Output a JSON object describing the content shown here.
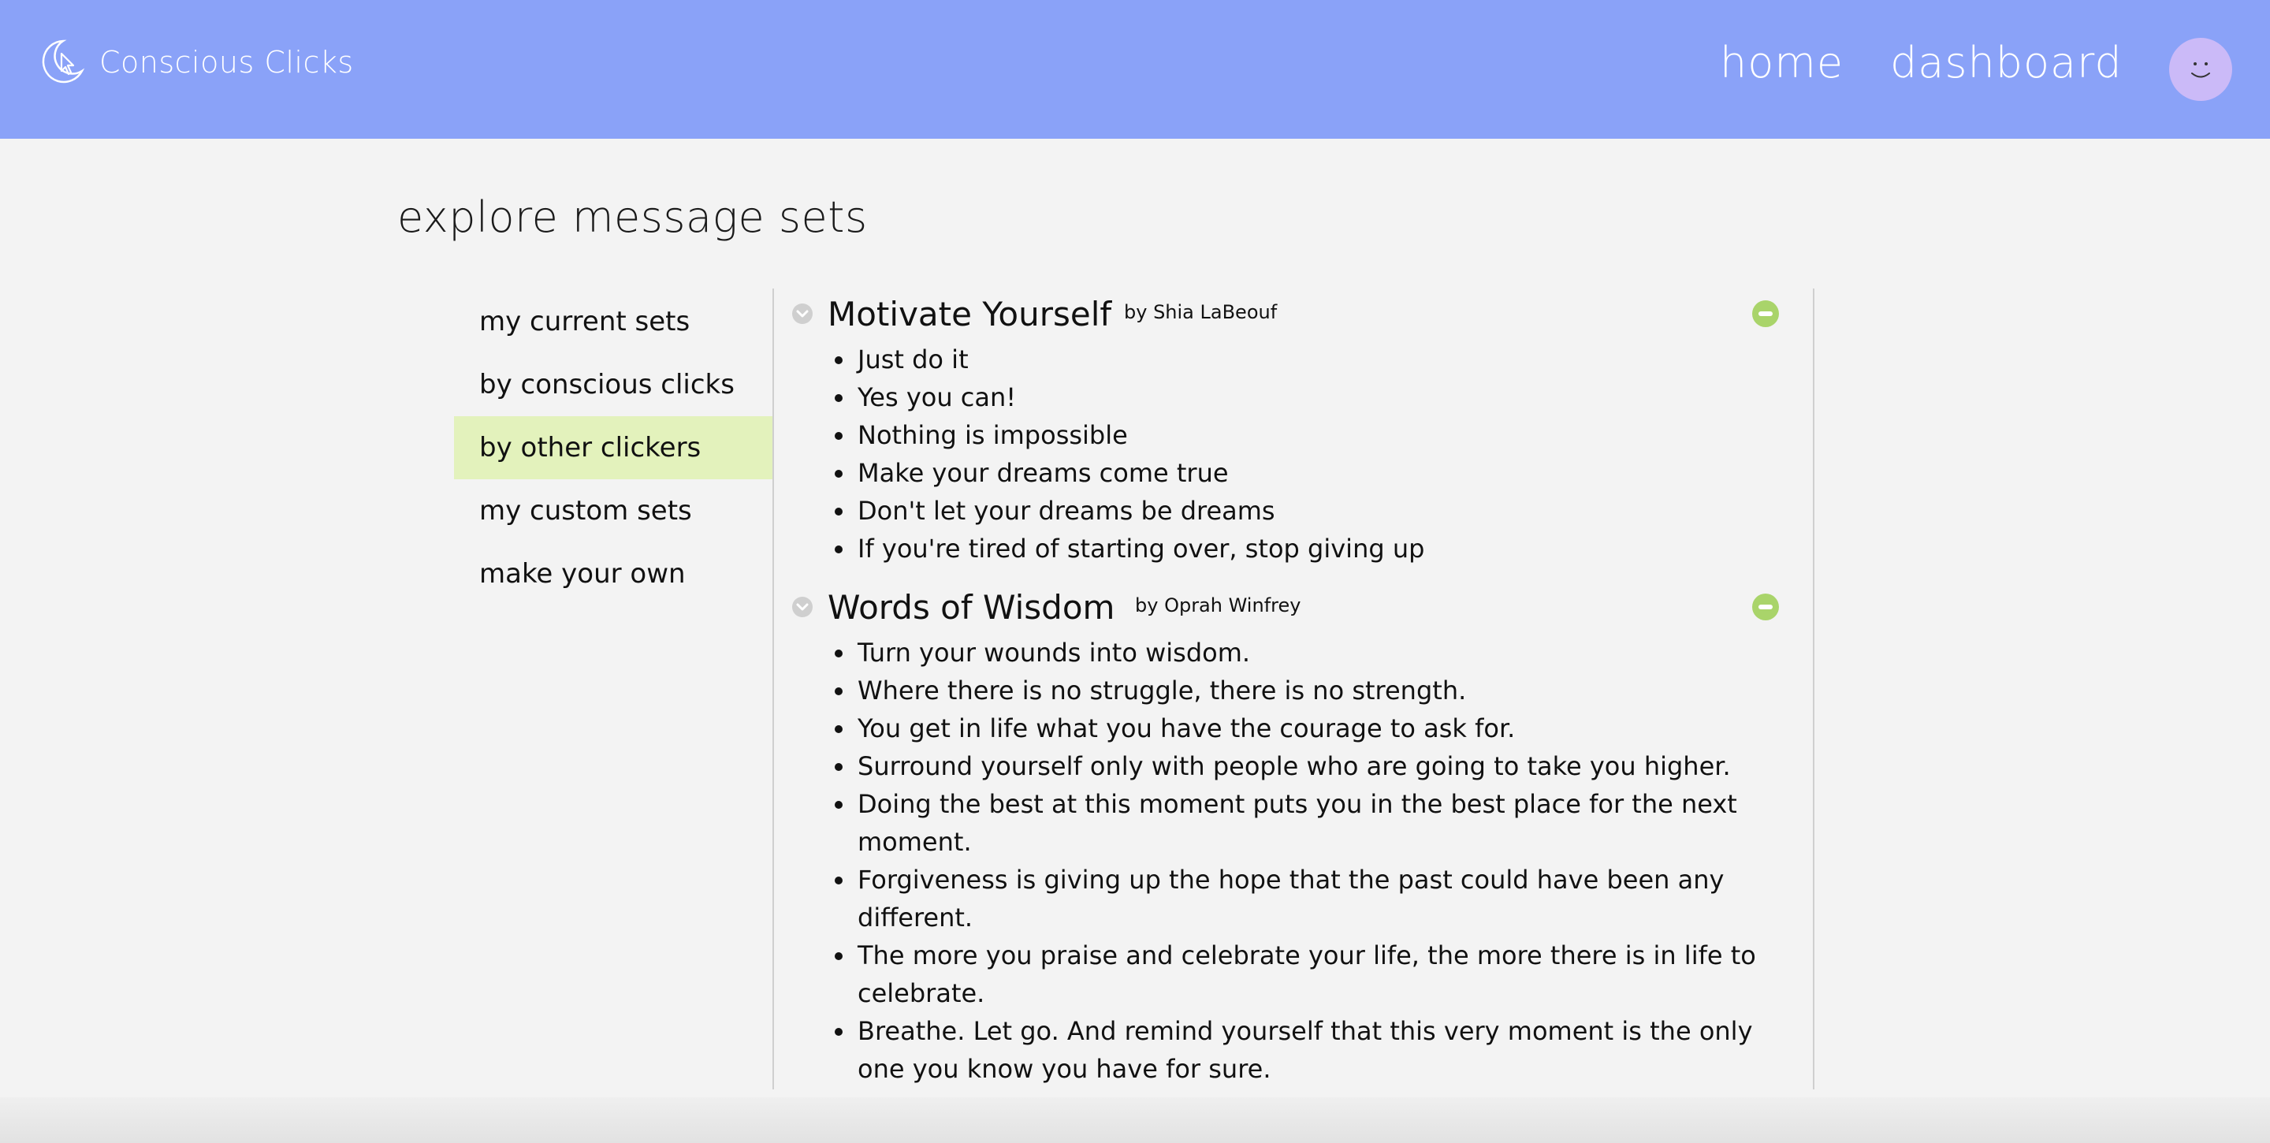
{
  "header": {
    "brand_name": "Conscious Clicks",
    "nav": {
      "home_label": "home",
      "dashboard_label": "dashboard"
    },
    "colors": {
      "bar": "#8aa2f8",
      "avatar": "#cbbaf8"
    },
    "icons": {
      "logo": "moon-cursor-logo-icon",
      "avatar": "smiley-avatar-icon"
    }
  },
  "page": {
    "title": "explore message sets"
  },
  "sidebar": {
    "items": [
      {
        "label": "my current sets",
        "active": false
      },
      {
        "label": "by conscious clicks",
        "active": false
      },
      {
        "label": "by other clickers",
        "active": true
      },
      {
        "label": "my custom sets",
        "active": false
      },
      {
        "label": "make your own",
        "active": false
      }
    ],
    "active_color": "#e3f2bc"
  },
  "sets": [
    {
      "title": "Motivate Yourself",
      "author": "by Shia LaBeouf",
      "messages": [
        "Just do it",
        "Yes you can!",
        "Nothing is impossible",
        "Make your dreams come true",
        "Don't let your dreams be dreams",
        "If you're tired of starting over, stop giving up"
      ]
    },
    {
      "title": "Words of Wisdom",
      "author": "by Oprah Winfrey",
      "messages": [
        "Turn your wounds into wisdom.",
        "Where there is no struggle, there is no strength.",
        "You get in life what you have the courage to ask for.",
        "Surround yourself only with people who are going to take you higher.",
        "Doing the best at this moment puts you in the best place for the next moment.",
        "Forgiveness is giving up the hope that the past could have been any different.",
        "The more you praise and celebrate your life, the more there is in life to celebrate.",
        "Breathe. Let go. And remind yourself that this very moment is the only one you know you have for sure."
      ]
    }
  ],
  "icons": {
    "collapse": "chevron-down-circle-icon",
    "remove": "minus-circle-icon",
    "remove_color": "#a9d46a"
  }
}
